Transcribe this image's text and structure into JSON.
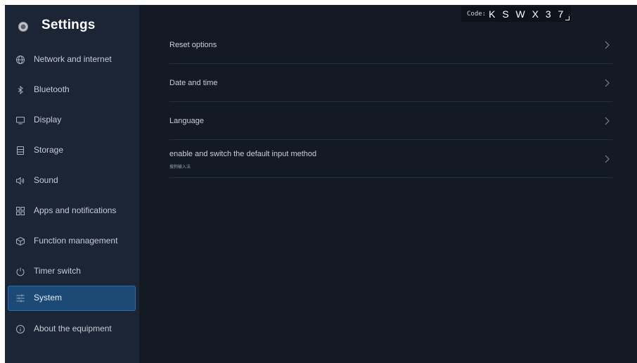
{
  "app": {
    "title": "Settings",
    "icon": "settings-app-icon"
  },
  "code": {
    "label": "Code:",
    "value": "K S W X 3 7"
  },
  "sidebar": {
    "items": [
      {
        "label": "Network and internet",
        "icon": "globe-icon",
        "active": false
      },
      {
        "label": "Bluetooth",
        "icon": "bluetooth-icon",
        "active": false
      },
      {
        "label": "Display",
        "icon": "monitor-icon",
        "active": false
      },
      {
        "label": "Storage",
        "icon": "storage-icon",
        "active": false
      },
      {
        "label": "Sound",
        "icon": "speaker-icon",
        "active": false
      },
      {
        "label": "Apps and notifications",
        "icon": "apps-grid-icon",
        "active": false
      },
      {
        "label": "Function management",
        "icon": "cube-icon",
        "active": false
      },
      {
        "label": "Timer switch",
        "icon": "power-icon",
        "active": false
      },
      {
        "label": "System",
        "icon": "sliders-icon",
        "active": true
      },
      {
        "label": "About the equipment",
        "icon": "info-icon",
        "active": false
      }
    ]
  },
  "main": {
    "rows": [
      {
        "label": "Reset options",
        "subtitle": ""
      },
      {
        "label": "Date and time",
        "subtitle": ""
      },
      {
        "label": "Language",
        "subtitle": ""
      },
      {
        "label": "enable and switch the default input method",
        "subtitle": "搜狗输入法"
      }
    ]
  },
  "colors": {
    "background": "#131a24",
    "sidebar": "#1b2535",
    "active_item": "#1c4976",
    "text": "#c9cfd6"
  }
}
